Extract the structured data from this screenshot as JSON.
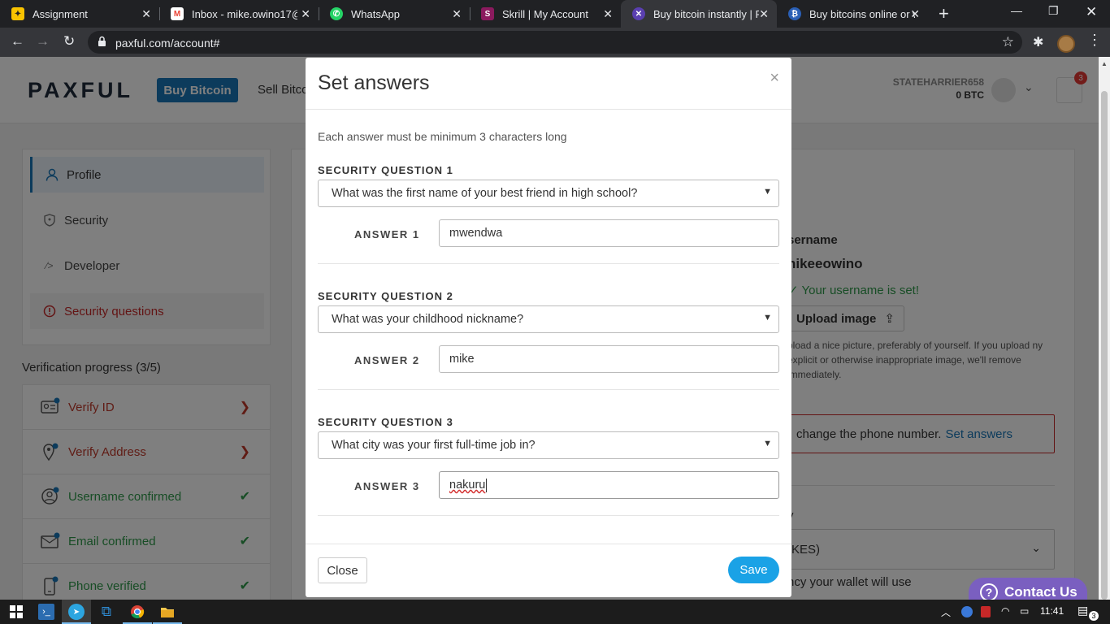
{
  "browser": {
    "tabs": [
      {
        "title": "Assignment",
        "icon": "assignment-favicon",
        "color": "#f9c300",
        "active": false
      },
      {
        "title": "Inbox - mike.owino17@",
        "icon": "gmail-favicon",
        "color": "#ea4335",
        "active": false
      },
      {
        "title": "WhatsApp",
        "icon": "whatsapp-favicon",
        "color": "#25d366",
        "active": false
      },
      {
        "title": "Skrill | My Account",
        "icon": "skrill-favicon",
        "color": "#8b1a5e",
        "active": false
      },
      {
        "title": "Buy bitcoin instantly | P",
        "icon": "paxful-favicon",
        "color": "#5a3fb0",
        "active": true
      },
      {
        "title": "Buy bitcoins online or w",
        "icon": "bitcoin-favicon",
        "color": "#2a5fb5",
        "active": false
      }
    ],
    "url": "paxful.com/account#"
  },
  "site": {
    "logo": "PAXFUL",
    "buy_label": "Buy Bitcoin",
    "sell_label": "Sell Bitco",
    "username": "STATEHARRIER658",
    "balance": "0 BTC",
    "notifications": "3"
  },
  "sidebar": {
    "items": [
      {
        "label": "Profile"
      },
      {
        "label": "Security"
      },
      {
        "label": "Developer"
      },
      {
        "label": "Security questions"
      }
    ]
  },
  "verification": {
    "title": "Verification progress (3/5)",
    "items": [
      {
        "label": "Verify ID",
        "status": "pending"
      },
      {
        "label": "Verify Address",
        "status": "pending"
      },
      {
        "label": "Username confirmed",
        "status": "done"
      },
      {
        "label": "Email confirmed",
        "status": "done"
      },
      {
        "label": "Phone verified",
        "status": "done"
      }
    ]
  },
  "profile_bg": {
    "username_label": "sername",
    "username": "nikeeowino",
    "username_set": "Your username is set!",
    "upload_label": "Upload image",
    "upload_help": "pload a nice picture, preferably of yourself. If you upload ny explicit or otherwise inappropriate image, we'll remove immediately.",
    "phone_warning": "change the phone number.",
    "phone_link": "Set answers",
    "y_label": "y",
    "currency_value": "KES)",
    "wallet_text": "ncy your wallet will use",
    "contact_us": "Contact Us"
  },
  "modal": {
    "title": "Set answers",
    "close_x": "×",
    "hint": "Each answer must be minimum 3 characters long",
    "questions": [
      {
        "label": "SECURITY QUESTION 1",
        "question": "What was the first name of your best friend in high school?",
        "answer_label": "ANSWER 1",
        "answer": "mwendwa"
      },
      {
        "label": "SECURITY QUESTION 2",
        "question": "What was your childhood nickname?",
        "answer_label": "ANSWER 2",
        "answer": "mike"
      },
      {
        "label": "SECURITY QUESTION 3",
        "question": "What city was your first full-time job in?",
        "answer_label": "ANSWER 3",
        "answer": "nakuru"
      }
    ],
    "close_label": "Close",
    "save_label": "Save"
  },
  "taskbar": {
    "time": "11:41",
    "notification_count": "3"
  },
  "colors": {
    "brand_blue": "#1976b8",
    "save_blue": "#1aa2e6",
    "error_red": "#c62828",
    "success_green": "#2e9a4a",
    "contact_purple": "#7a5fc0"
  }
}
